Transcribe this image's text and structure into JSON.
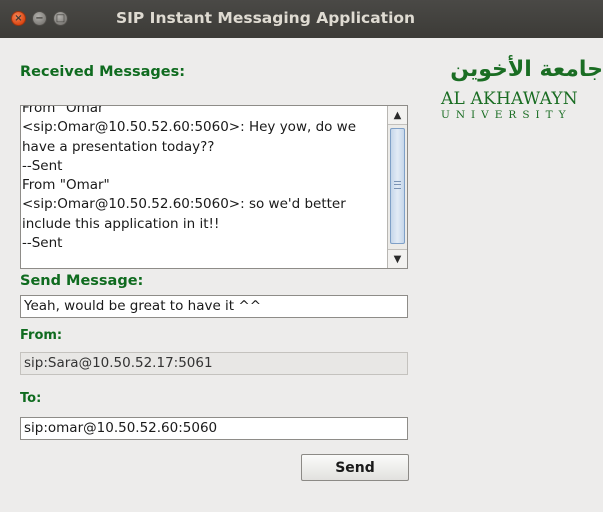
{
  "window": {
    "title": "SIP Instant Messaging Application",
    "close_glyph": "×",
    "minimize_glyph": "−",
    "maximize_glyph": "□"
  },
  "received": {
    "label": "Received Messages:",
    "text": "From \"Omar\"\n<sip:Omar@10.50.52.60:5060>: Hey yow, do we have a presentation today??\n--Sent\nFrom \"Omar\"\n<sip:Omar@10.50.52.60:5060>: so we'd better include this application in it!!\n--Sent"
  },
  "send": {
    "label": "Send Message:",
    "value": "Yeah, would be great to have it ^^"
  },
  "from": {
    "label": "From:",
    "value": "sip:Sara@10.50.52.17:5061"
  },
  "to": {
    "label": "To:",
    "value": "sip:omar@10.50.52.60:5060"
  },
  "send_button": {
    "label": "Send"
  },
  "logo": {
    "arabic": "جامعة الأخوين",
    "line1": "AL AKHAWAYN",
    "line2": "UNIVERSITY"
  },
  "scrollbar": {
    "up_glyph": "▲",
    "down_glyph": "▼"
  },
  "colors": {
    "label_green": "#0f6b1f",
    "titlebar": "#3c3b37",
    "window_bg": "#edeceb",
    "close_button": "#dd4814"
  }
}
